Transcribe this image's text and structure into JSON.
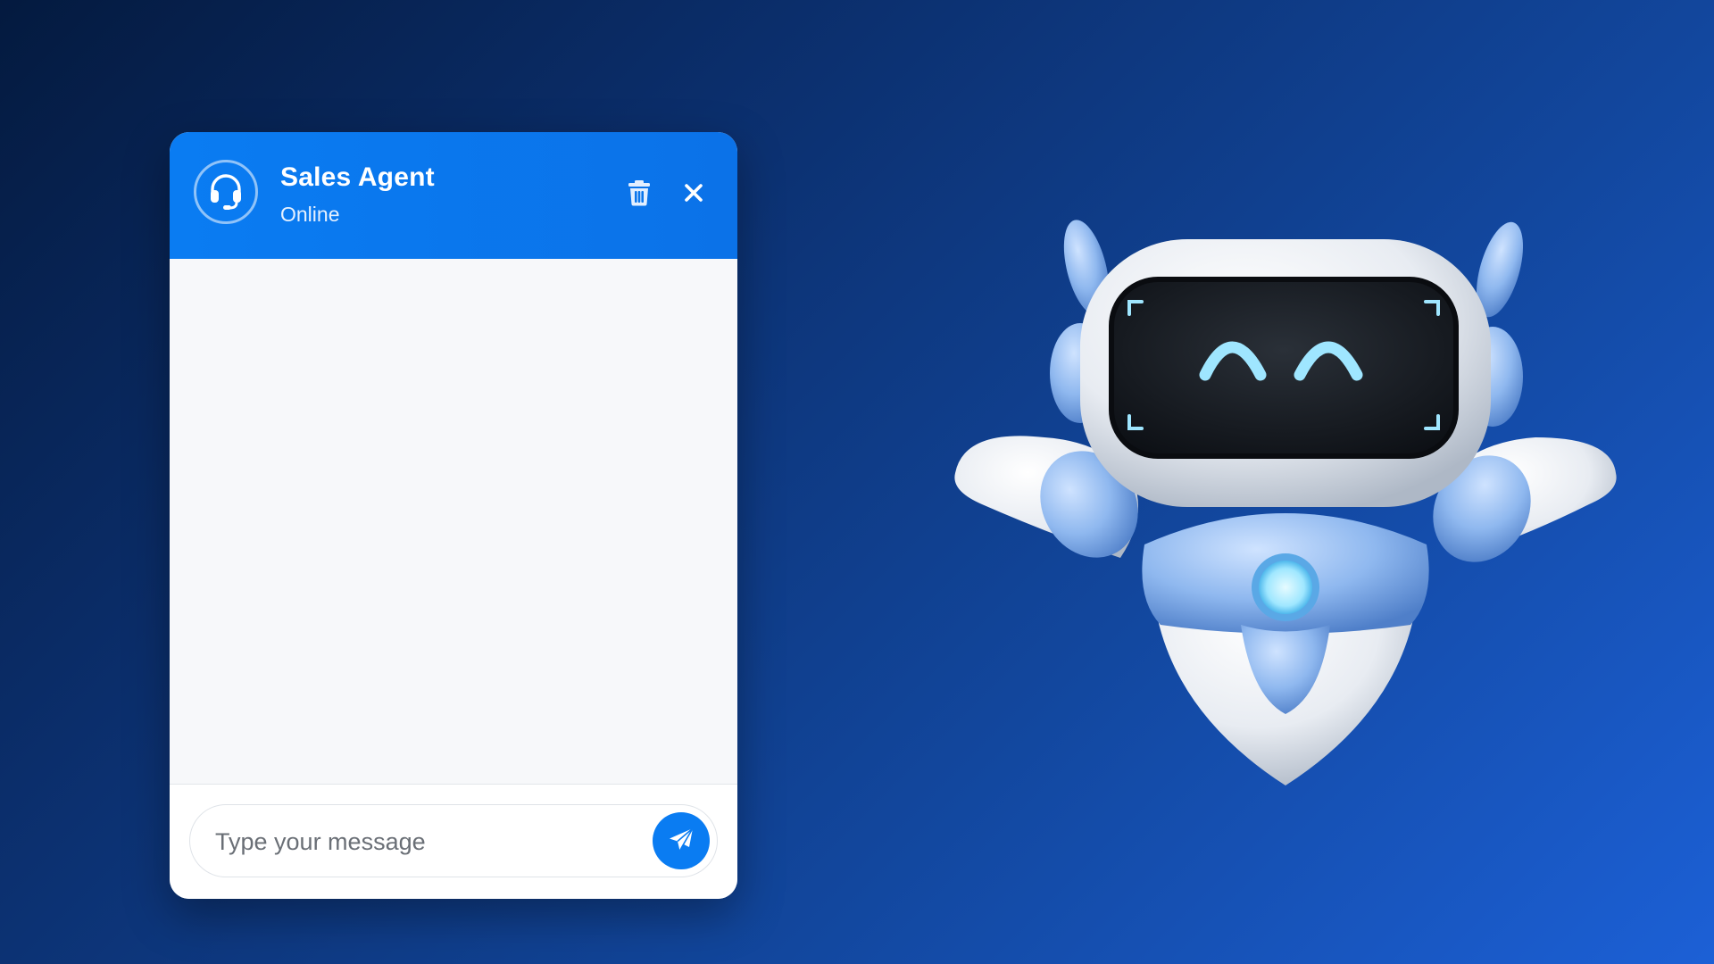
{
  "chat": {
    "agent_name": "Sales Agent",
    "agent_status": "Online",
    "input_placeholder": "Type your message",
    "icons": {
      "avatar": "headset-icon",
      "delete": "trash-icon",
      "close": "close-icon",
      "send": "paper-plane-icon"
    }
  },
  "colors": {
    "accent": "#0a7cf2",
    "background_start": "#041a3f",
    "background_end": "#1c60d6",
    "chat_body": "#f7f8fa"
  }
}
